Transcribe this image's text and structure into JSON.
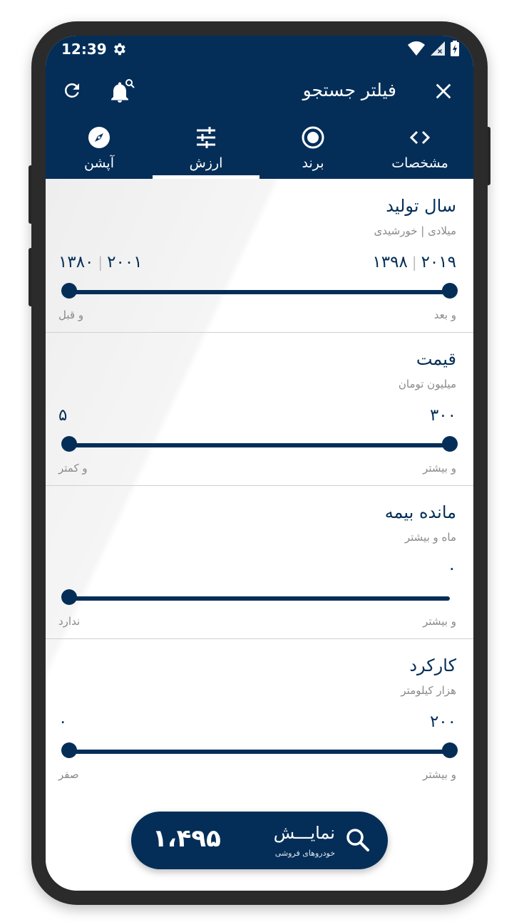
{
  "status_bar": {
    "time": "12:39"
  },
  "header": {
    "title": "فیلتر جستجو"
  },
  "tabs": [
    {
      "label": "مشخصات",
      "icon": "code-icon",
      "active": false
    },
    {
      "label": "برند",
      "icon": "radio-target-icon",
      "active": false
    },
    {
      "label": "ارزش",
      "icon": "sliders-icon",
      "active": true
    },
    {
      "label": "آپشن",
      "icon": "compass-icon",
      "active": false
    }
  ],
  "sections": [
    {
      "title": "سال تولید",
      "subtitle": "میلادی | خورشیدی",
      "max_value_gregorian": "۲۰۱۹",
      "max_value_solar": "۱۳۹۸",
      "min_value_gregorian": "۲۰۰۱",
      "min_value_solar": "۱۳۸۰",
      "max_caption": "و بعد",
      "min_caption": "و قبل"
    },
    {
      "title": "قیمت",
      "subtitle": "میلیون تومان",
      "max_value": "۳۰۰",
      "min_value": "۵",
      "max_caption": "و بیشتر",
      "min_caption": "و کمتر"
    },
    {
      "title": "مانده بیمه",
      "subtitle": "ماه و بیشتر",
      "value": "۰",
      "max_caption": "و بیشتر",
      "min_caption": "ندارد"
    },
    {
      "title": "کارکرد",
      "subtitle": "هزار کیلومتر",
      "max_value": "۲۰۰",
      "min_value": "۰",
      "max_caption": "و بیشتر",
      "min_caption": "صفر"
    }
  ],
  "show_button": {
    "label": "نمایـــش",
    "sublabel": "خودروهای فروشی",
    "count": "۱،۴۹۵"
  },
  "colors": {
    "primary": "#042e58",
    "muted": "#8a8a8a",
    "divider": "#d0d0d0"
  }
}
